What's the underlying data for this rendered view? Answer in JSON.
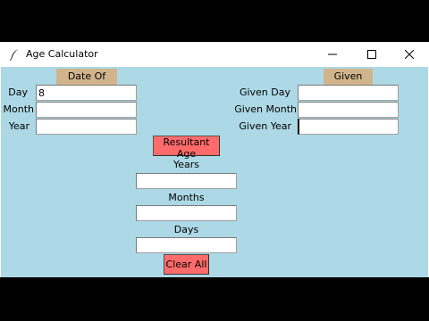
{
  "window": {
    "title": "Age Calculator"
  },
  "dob": {
    "header": "Date Of Birth",
    "day_label": "Day",
    "day_value": "8",
    "month_label": "Month",
    "month_value": "",
    "year_label": "Year",
    "year_value": ""
  },
  "given": {
    "header": "Given Date",
    "day_label": "Given Day",
    "day_value": "",
    "month_label": "Given Month",
    "month_value": "",
    "year_label": "Given Year",
    "year_value": ""
  },
  "result": {
    "button_label": "Resultant Age",
    "years_label": "Years",
    "years_value": "",
    "months_label": "Months",
    "months_value": "",
    "days_label": "Days",
    "days_value": "",
    "clear_label": "Clear All"
  },
  "colors": {
    "background": "#add8e6",
    "header": "#d2b48c",
    "button": "#ff6b6b"
  }
}
